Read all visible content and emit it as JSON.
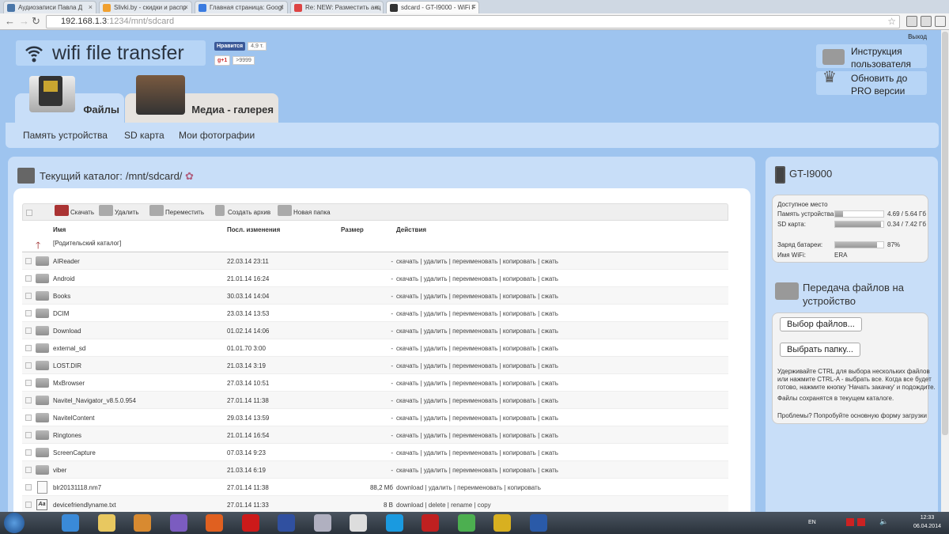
{
  "browser": {
    "tabs": [
      {
        "label": "Аудиозаписи Павла Д",
        "color": "#4a76a8"
      },
      {
        "label": "Slivki.by - скидки и распр",
        "color": "#f0a030"
      },
      {
        "label": "Главная страница: Googl",
        "color": "#3a7be0"
      },
      {
        "label": "Re: NEW: Разместить акц",
        "color": "#d44"
      },
      {
        "label": "sdcard - GT-I9000 - WiFi F",
        "color": "#333"
      }
    ],
    "url_host": "192.168.1.3",
    "url_rest": ":1234/mnt/sdcard"
  },
  "header": {
    "logout": "Выход",
    "logo": "wifi file transfer",
    "fb_label": "Нравится",
    "fb_count": "4,9 т.",
    "gp_label": "g+1",
    "gp_count": ">9999",
    "help": "Инструкция пользователя",
    "upgrade": "Обновить до PRO версии",
    "tabs": [
      "Файлы",
      "Медиа - галерея"
    ],
    "subnav": [
      "Память устройства",
      "SD карта",
      "Мои фотографии"
    ]
  },
  "main": {
    "current_label": "Текущий каталог:",
    "current_path": "/mnt/sdcard/",
    "toolbar": [
      "Скачать",
      "Удалить",
      "Переместить",
      "Создать архив",
      "Новая папка"
    ],
    "columns": [
      "Имя",
      "Посл. изменения",
      "Размер",
      "Действия"
    ],
    "parent": "[Родительский каталог]",
    "rows": [
      {
        "type": "folder",
        "name": "AIReader",
        "date": "22.03.14 23:11",
        "size": "-",
        "actions": "скачать | удалить | переименовать | копировать | сжать"
      },
      {
        "type": "folder",
        "name": "Android",
        "date": "21.01.14 16:24",
        "size": "-",
        "actions": "скачать | удалить | переименовать | копировать | сжать"
      },
      {
        "type": "folder",
        "name": "Books",
        "date": "30.03.14 14:04",
        "size": "-",
        "actions": "скачать | удалить | переименовать | копировать | сжать"
      },
      {
        "type": "folder",
        "name": "DCIM",
        "date": "23.03.14 13:53",
        "size": "-",
        "actions": "скачать | удалить | переименовать | копировать | сжать"
      },
      {
        "type": "folder",
        "name": "Download",
        "date": "01.02.14 14:06",
        "size": "-",
        "actions": "скачать | удалить | переименовать | копировать | сжать"
      },
      {
        "type": "folder",
        "name": "external_sd",
        "date": "01.01.70 3:00",
        "size": "-",
        "actions": "скачать | удалить | переименовать | копировать | сжать"
      },
      {
        "type": "folder",
        "name": "LOST.DIR",
        "date": "21.03.14 3:19",
        "size": "-",
        "actions": "скачать | удалить | переименовать | копировать | сжать"
      },
      {
        "type": "folder",
        "name": "MxBrowser",
        "date": "27.03.14 10:51",
        "size": "-",
        "actions": "скачать | удалить | переименовать | копировать | сжать"
      },
      {
        "type": "folder",
        "name": "Navitel_Navigator_v8.5.0.954",
        "date": "27.01.14 11:38",
        "size": "-",
        "actions": "скачать | удалить | переименовать | копировать | сжать"
      },
      {
        "type": "folder",
        "name": "NavitelContent",
        "date": "29.03.14 13:59",
        "size": "-",
        "actions": "скачать | удалить | переименовать | копировать | сжать"
      },
      {
        "type": "folder",
        "name": "Ringtones",
        "date": "21.01.14 16:54",
        "size": "-",
        "actions": "скачать | удалить | переименовать | копировать | сжать"
      },
      {
        "type": "folder",
        "name": "ScreenCapture",
        "date": "07.03.14 9:23",
        "size": "-",
        "actions": "скачать | удалить | переименовать | копировать | сжать"
      },
      {
        "type": "folder",
        "name": "viber",
        "date": "21.03.14 6:19",
        "size": "-",
        "actions": "скачать | удалить | переименовать | копировать | сжать"
      },
      {
        "type": "file",
        "name": "blr20131118.nm7",
        "date": "27.01.14 11:38",
        "size": "88,2 Мб",
        "actions": "download | удалить | переименовать | копировать"
      },
      {
        "type": "text",
        "icon_label": "Aa",
        "name": "devicefriendlyname.txt",
        "date": "27.01.14 11:33",
        "size": "8 B",
        "actions": "download | delete | rename | copy"
      }
    ]
  },
  "side": {
    "device": "GT-I9000",
    "space_label": "Доступное место",
    "device_mem_label": "Память устройства:",
    "device_mem_value": "4.69 / 5.64 Гб",
    "device_mem_used_fraction": 0.17,
    "sd_label": "SD карта:",
    "sd_value": "0.34 / 7.42 Гб",
    "sd_used_fraction": 0.95,
    "battery_label": "Заряд батареи:",
    "battery_value": "87%",
    "battery_fraction": 0.87,
    "wifi_label": "Имя WiFi:",
    "wifi_value": "ERA",
    "upload_title": "Передача файлов на устройство",
    "choose_files": "Выбор файлов...",
    "choose_folder": "Выбрать папку...",
    "note": "Удерживайте CTRL для выбора нескольких файлов или нажмите CTRL-A - выбрать все. Когда все будет готово, нажмите кнопку 'Начать закачку' и подождите.",
    "note2": "Файлы сохранятся в текущем каталоге.",
    "problems": "Проблемы? Попробуйте основную форму загрузки"
  },
  "taskbar": {
    "lang": "EN",
    "time": "12:33",
    "date": "06.04.2014",
    "apps": [
      {
        "name": "internet-explorer",
        "color": "#3a8ad8"
      },
      {
        "name": "file-explorer",
        "color": "#e8c860"
      },
      {
        "name": "media-player",
        "color": "#d88a30"
      },
      {
        "name": "viber",
        "color": "#7b5cc0"
      },
      {
        "name": "firefox",
        "color": "#e06020"
      },
      {
        "name": "opera",
        "color": "#cc1a1a"
      },
      {
        "name": "floppy-app",
        "color": "#3050a0"
      },
      {
        "name": "paint-app",
        "color": "#b0b0c0"
      },
      {
        "name": "media-classic",
        "color": "#dddddd"
      },
      {
        "name": "skype",
        "color": "#1a9ae0"
      },
      {
        "name": "filezilla",
        "color": "#c02020"
      },
      {
        "name": "chrome",
        "color": "#4caf50"
      },
      {
        "name": "webcam-app",
        "color": "#d8b020"
      },
      {
        "name": "word",
        "color": "#2a5aa8"
      }
    ]
  }
}
